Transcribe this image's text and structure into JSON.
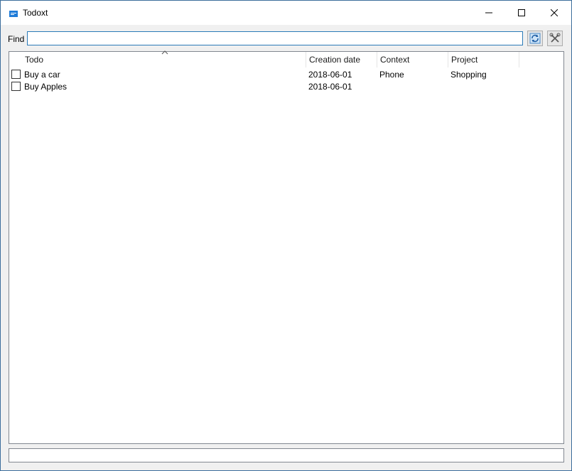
{
  "window": {
    "title": "Todoxt",
    "icon": "notepad-icon",
    "controls": [
      "minimize-icon",
      "maximize-icon",
      "close-icon"
    ]
  },
  "toolbar": {
    "find_label": "Find",
    "find_value": "",
    "refresh_icon": "refresh-icon",
    "settings_icon": "tools-icon"
  },
  "list": {
    "columns": [
      "Todo",
      "Creation date",
      "Context",
      "Project"
    ],
    "sorted_column": "Todo",
    "rows": [
      {
        "checked": false,
        "todo": "Buy a car",
        "creation_date": "2018-06-01",
        "context": "Phone",
        "project": "Shopping"
      },
      {
        "checked": false,
        "todo": "Buy Apples",
        "creation_date": "2018-06-01",
        "context": "",
        "project": ""
      }
    ]
  },
  "status": {
    "text": ""
  },
  "colors": {
    "titlebar": "#ffffff",
    "accent": "#2a7ab8",
    "desktop": "#2b5a84"
  }
}
